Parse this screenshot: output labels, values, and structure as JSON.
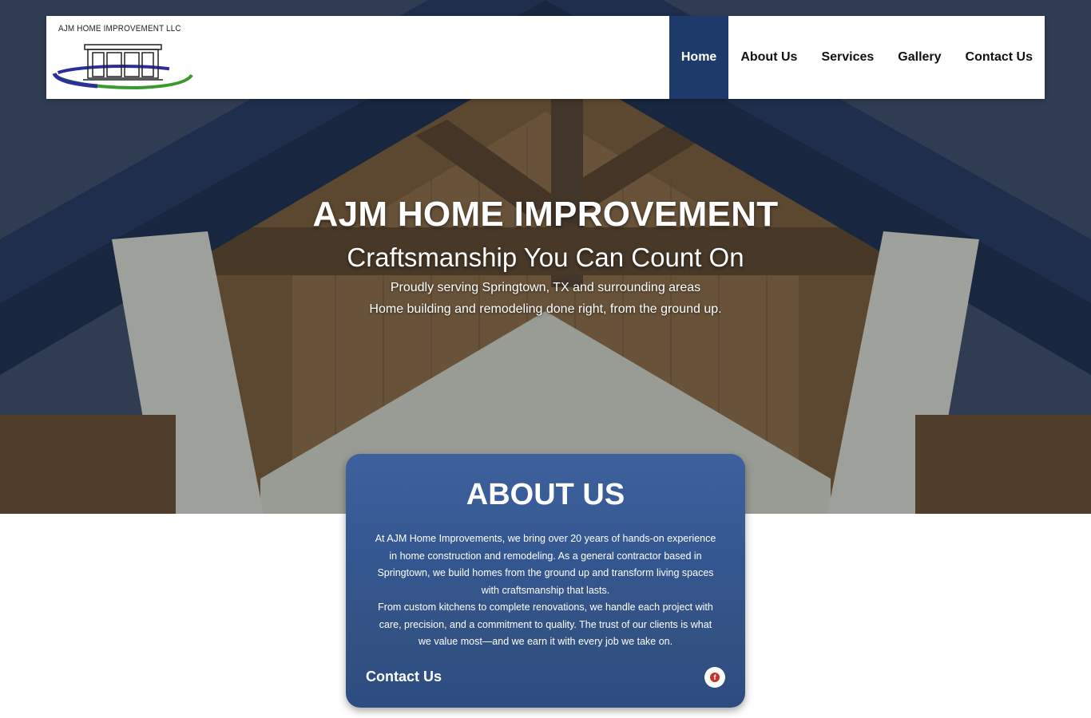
{
  "header": {
    "logo_text": "AJM HOME IMPROVEMENT LLC",
    "nav": [
      {
        "label": "Home",
        "active": true
      },
      {
        "label": "About Us",
        "active": false
      },
      {
        "label": "Services",
        "active": false
      },
      {
        "label": "Gallery",
        "active": false
      },
      {
        "label": "Contact Us",
        "active": false
      }
    ]
  },
  "hero": {
    "title": "AJM HOME IMPROVEMENT",
    "subtitle": "Craftsmanship You Can Count On",
    "line1": "Proudly serving Springtown, TX and surrounding areas",
    "line2": "Home building and remodeling done right, from the ground up."
  },
  "about": {
    "title": "ABOUT US",
    "body_lines": [
      "At AJM Home Improvements, we bring over 20 years of hands-on experience",
      "in home construction and remodeling. As a general contractor based in",
      "Springtown, we build homes from the ground up and transform living spaces",
      "with craftsmanship that lasts.",
      "From custom kitchens to complete renovations, we handle each project with",
      "care, precision, and a commitment to quality. The trust of our clients is what",
      "we value most—and we earn it with every job we take on."
    ],
    "contact_label": "Contact Us",
    "social_icon": "facebook-icon"
  },
  "colors": {
    "nav_active": "#1d3a6a",
    "card_blue": "#345896",
    "facebook_red": "#c9302c"
  }
}
